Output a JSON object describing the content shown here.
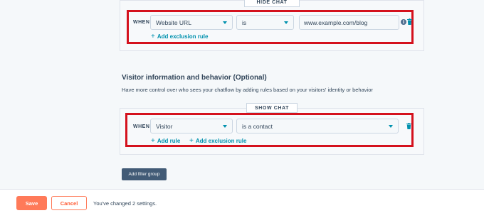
{
  "hide_chat": {
    "tag": "HIDE CHAT",
    "when_label": "WHEN",
    "property": "Website URL",
    "operator": "is",
    "value": "www.example.com/blog",
    "add_exclusion_rule": "Add exclusion rule"
  },
  "visitor_section": {
    "title": "Visitor information and behavior (Optional)",
    "description": "Have more control over who sees your chatflow by adding rules based on your visitors' identity or behavior"
  },
  "show_chat": {
    "tag": "SHOW CHAT",
    "when_label": "WHEN",
    "property": "Visitor",
    "operator": "is a contact",
    "add_rule": "Add rule",
    "add_exclusion_rule": "Add exclusion rule"
  },
  "add_filter_group": "Add filter group",
  "footer": {
    "save": "Save",
    "cancel": "Cancel",
    "status": "You've changed 2 settings."
  },
  "colors": {
    "highlight": "#d4111d",
    "accent": "#0091ae",
    "primary_button": "#ff7a59",
    "dark_button": "#425b76"
  }
}
